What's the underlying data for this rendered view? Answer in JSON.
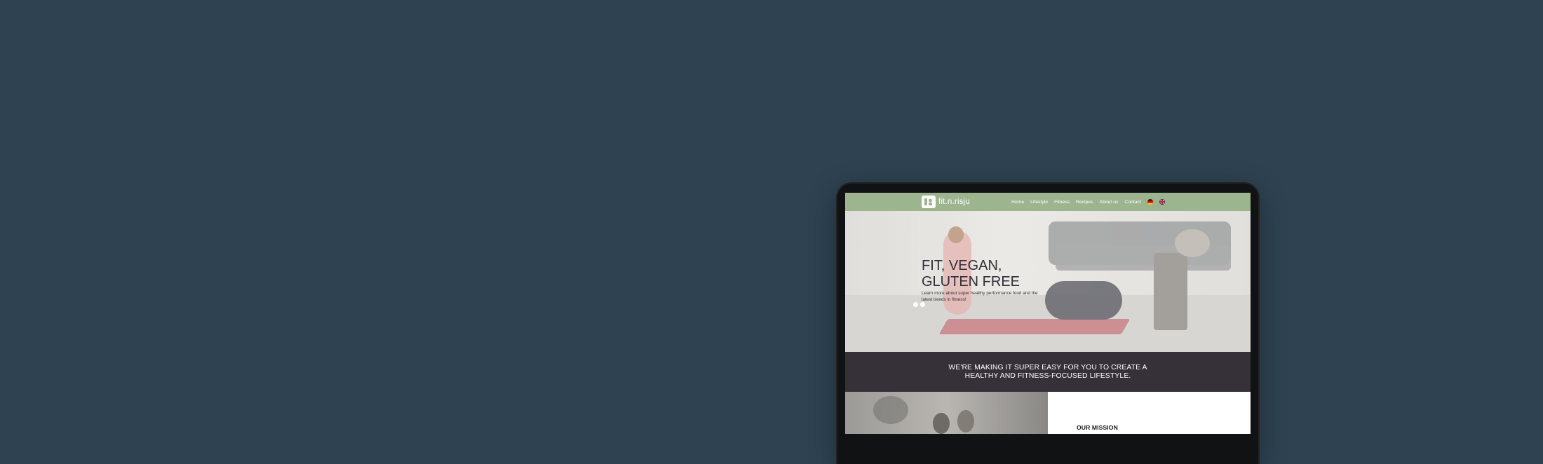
{
  "site": {
    "logo_text": "fit.n.risju",
    "nav": [
      "Home",
      "Lifestyle",
      "Fitness",
      "Recipes",
      "About us",
      "Contact"
    ],
    "languages": [
      "de-flag",
      "en-flag"
    ]
  },
  "hero": {
    "title": "FIT, VEGAN, GLUTEN FREE",
    "text": "Learn more about super healthy performance food and the latest trends in fitness!"
  },
  "band": {
    "text": "WE'RE MAKING IT SUPER EASY FOR YOU TO CREATE A HEALTHY AND FITNESS-FOCUSED LIFESTYLE."
  },
  "mission": {
    "heading": "OUR MISSION"
  },
  "colors": {
    "background": "#2e4251",
    "header": "#9db58f",
    "band": "#363139"
  }
}
